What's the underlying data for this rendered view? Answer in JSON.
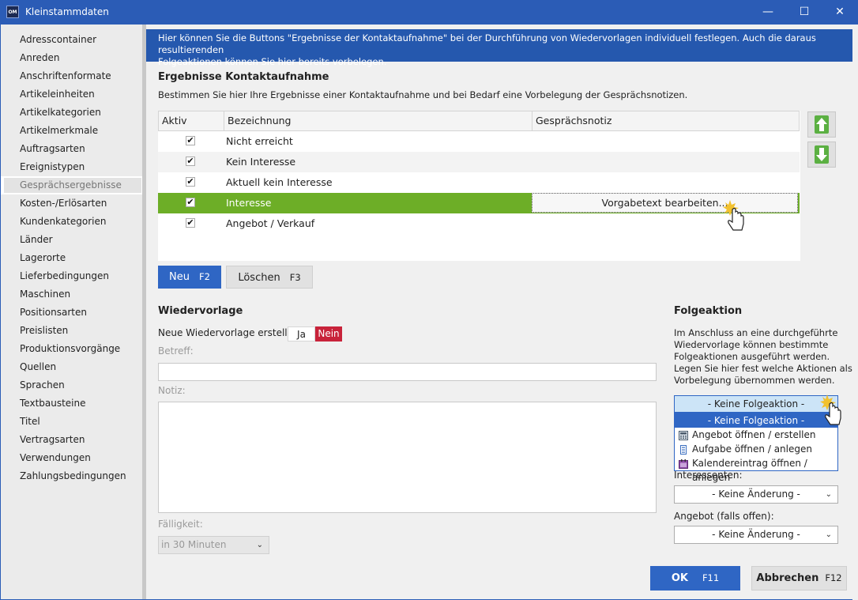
{
  "window": {
    "title": "Kleinstammdaten",
    "logo_text": "OM",
    "minimize": "—",
    "maximize": "☐",
    "close": "✕"
  },
  "sidebar": {
    "items": [
      {
        "label": "Adresscontainer"
      },
      {
        "label": "Anreden"
      },
      {
        "label": "Anschriftenformate"
      },
      {
        "label": "Artikeleinheiten"
      },
      {
        "label": "Artikelkategorien"
      },
      {
        "label": "Artikelmerkmale"
      },
      {
        "label": "Auftragsarten"
      },
      {
        "label": "Ereignistypen"
      },
      {
        "label": "Gesprächsergebnisse",
        "active": true
      },
      {
        "label": "Kosten-/Erlösarten"
      },
      {
        "label": "Kundenkategorien"
      },
      {
        "label": "Länder"
      },
      {
        "label": "Lagerorte"
      },
      {
        "label": "Lieferbedingungen"
      },
      {
        "label": "Maschinen"
      },
      {
        "label": "Positionsarten"
      },
      {
        "label": "Preislisten"
      },
      {
        "label": "Produktionsvorgänge"
      },
      {
        "label": "Quellen"
      },
      {
        "label": "Sprachen"
      },
      {
        "label": "Textbausteine"
      },
      {
        "label": "Titel"
      },
      {
        "label": "Vertragsarten"
      },
      {
        "label": "Verwendungen"
      },
      {
        "label": "Zahlungsbedingungen"
      }
    ]
  },
  "info": {
    "line1": "Hier können Sie die Buttons \"Ergebnisse der Kontaktaufnahme\" bei der Durchführung von Wiedervorlagen individuell festlegen. Auch die daraus resultierenden",
    "line2": "Folgeaktionen können Sie hier bereits vorbelegen."
  },
  "results": {
    "title": "Ergebnisse Kontaktaufnahme",
    "description": "Bestimmen Sie hier Ihre Ergebnisse einer Kontaktaufnahme und bei Bedarf eine Vorbelegung der Gesprächsnotizen.",
    "columns": [
      "Aktiv",
      "Bezeichnung",
      "Gesprächsnotiz"
    ],
    "rows": [
      {
        "active": true,
        "name": "Nicht erreicht",
        "note": ""
      },
      {
        "active": true,
        "name": "Kein Interesse",
        "note": ""
      },
      {
        "active": true,
        "name": "Aktuell kein Interesse",
        "note": ""
      },
      {
        "active": true,
        "name": "Interesse",
        "note": "Vorgabetext bearbeiten...",
        "selected": true
      },
      {
        "active": true,
        "name": "Angebot / Verkauf",
        "note": ""
      }
    ],
    "checkmark": "✔",
    "new_label": "Neu",
    "new_key": "F2",
    "delete_label": "Löschen",
    "delete_key": "F3"
  },
  "wiedervorlage": {
    "title": "Wiedervorlage",
    "create_label": "Neue Wiedervorlage erstellen",
    "yes": "Ja",
    "no": "Nein",
    "subject_label": "Betreff:",
    "subject_value": "",
    "note_label": "Notiz:",
    "note_value": "",
    "due_label": "Fälligkeit:",
    "due_value": "in 30 Minuten"
  },
  "folgeaktion": {
    "title": "Folgeaktion",
    "description": [
      "Im Anschluss an eine durchgeführte",
      "Wiedervorlage können bestimmte",
      "Folgeaktionen ausgeführt werden.",
      "Legen Sie hier fest welche Aktionen als",
      "Vorbelegung übernommen werden."
    ],
    "selected": "- Keine Folgeaktion -",
    "options": [
      {
        "label": "- Keine Folgeaktion -",
        "icon": "none"
      },
      {
        "label": "Angebot öffnen / erstellen",
        "icon": "calculator-icon"
      },
      {
        "label": "Aufgabe öffnen / anlegen",
        "icon": "task-list-icon"
      },
      {
        "label": "Kalendereintrag öffnen / anlegen",
        "icon": "calendar-icon"
      }
    ],
    "interessenten_label": "Interessenten:",
    "interessenten_value": "- Keine Änderung -",
    "angebot_label": "Angebot (falls offen):",
    "angebot_value": "- Keine Änderung -"
  },
  "footer": {
    "ok_label": "OK",
    "ok_key": "F11",
    "cancel_label": "Abbrechen",
    "cancel_key": "F12"
  },
  "colors": {
    "title_blue": "#2b5cb6",
    "selected_green": "#6dae27",
    "button_blue": "#2f66c4",
    "no_red": "#c8233a"
  }
}
